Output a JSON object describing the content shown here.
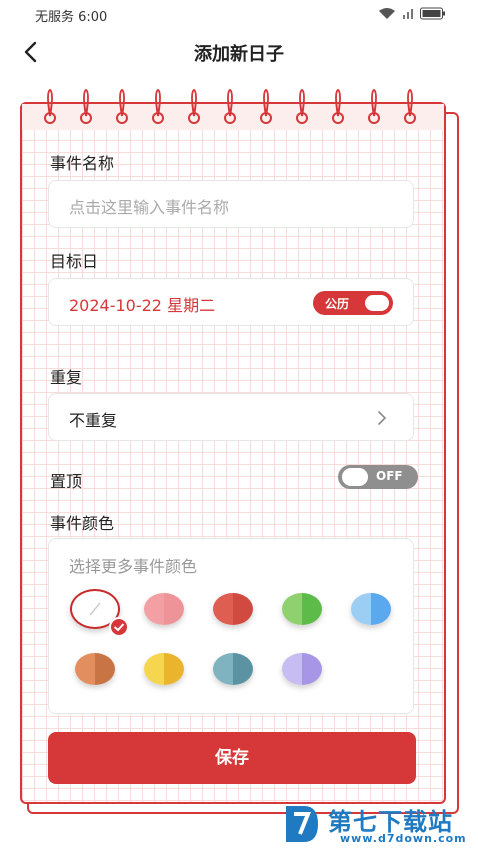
{
  "status_bar": {
    "carrier_time": "无服务 6:00"
  },
  "nav": {
    "title": "添加新日子"
  },
  "form": {
    "event_name_label": "事件名称",
    "event_name_placeholder": "点击这里输入事件名称",
    "target_date_label": "目标日",
    "target_date_value": "2024-10-22 星期二",
    "calendar_toggle_label": "公历",
    "repeat_label": "重复",
    "repeat_value": "不重复",
    "pin_label": "置顶",
    "pin_toggle_label": "OFF",
    "color_label": "事件颜色",
    "color_hint": "选择更多事件颜色",
    "colors": [
      {
        "left": "#ffffff",
        "right": "#ffffff",
        "selected": true
      },
      {
        "left": "#f2a0a4",
        "right": "#ee9498",
        "selected": false
      },
      {
        "left": "#de5f52",
        "right": "#d14a3f",
        "selected": false
      },
      {
        "left": "#8fd16e",
        "right": "#5dbb4a",
        "selected": false
      },
      {
        "left": "#9ccdf3",
        "right": "#5aa8ee",
        "selected": false
      },
      {
        "left": "#e28e5e",
        "right": "#c97444",
        "selected": false
      },
      {
        "left": "#f6d54f",
        "right": "#eab52c",
        "selected": false
      },
      {
        "left": "#7fb3c0",
        "right": "#5c93a3",
        "selected": false
      },
      {
        "left": "#c7bdf2",
        "right": "#a795e6",
        "selected": false
      }
    ],
    "save_label": "保存"
  },
  "watermark": {
    "title": "第七下载站",
    "url": "www.d7down.com"
  },
  "theme": {
    "accent": "#d6383a"
  }
}
